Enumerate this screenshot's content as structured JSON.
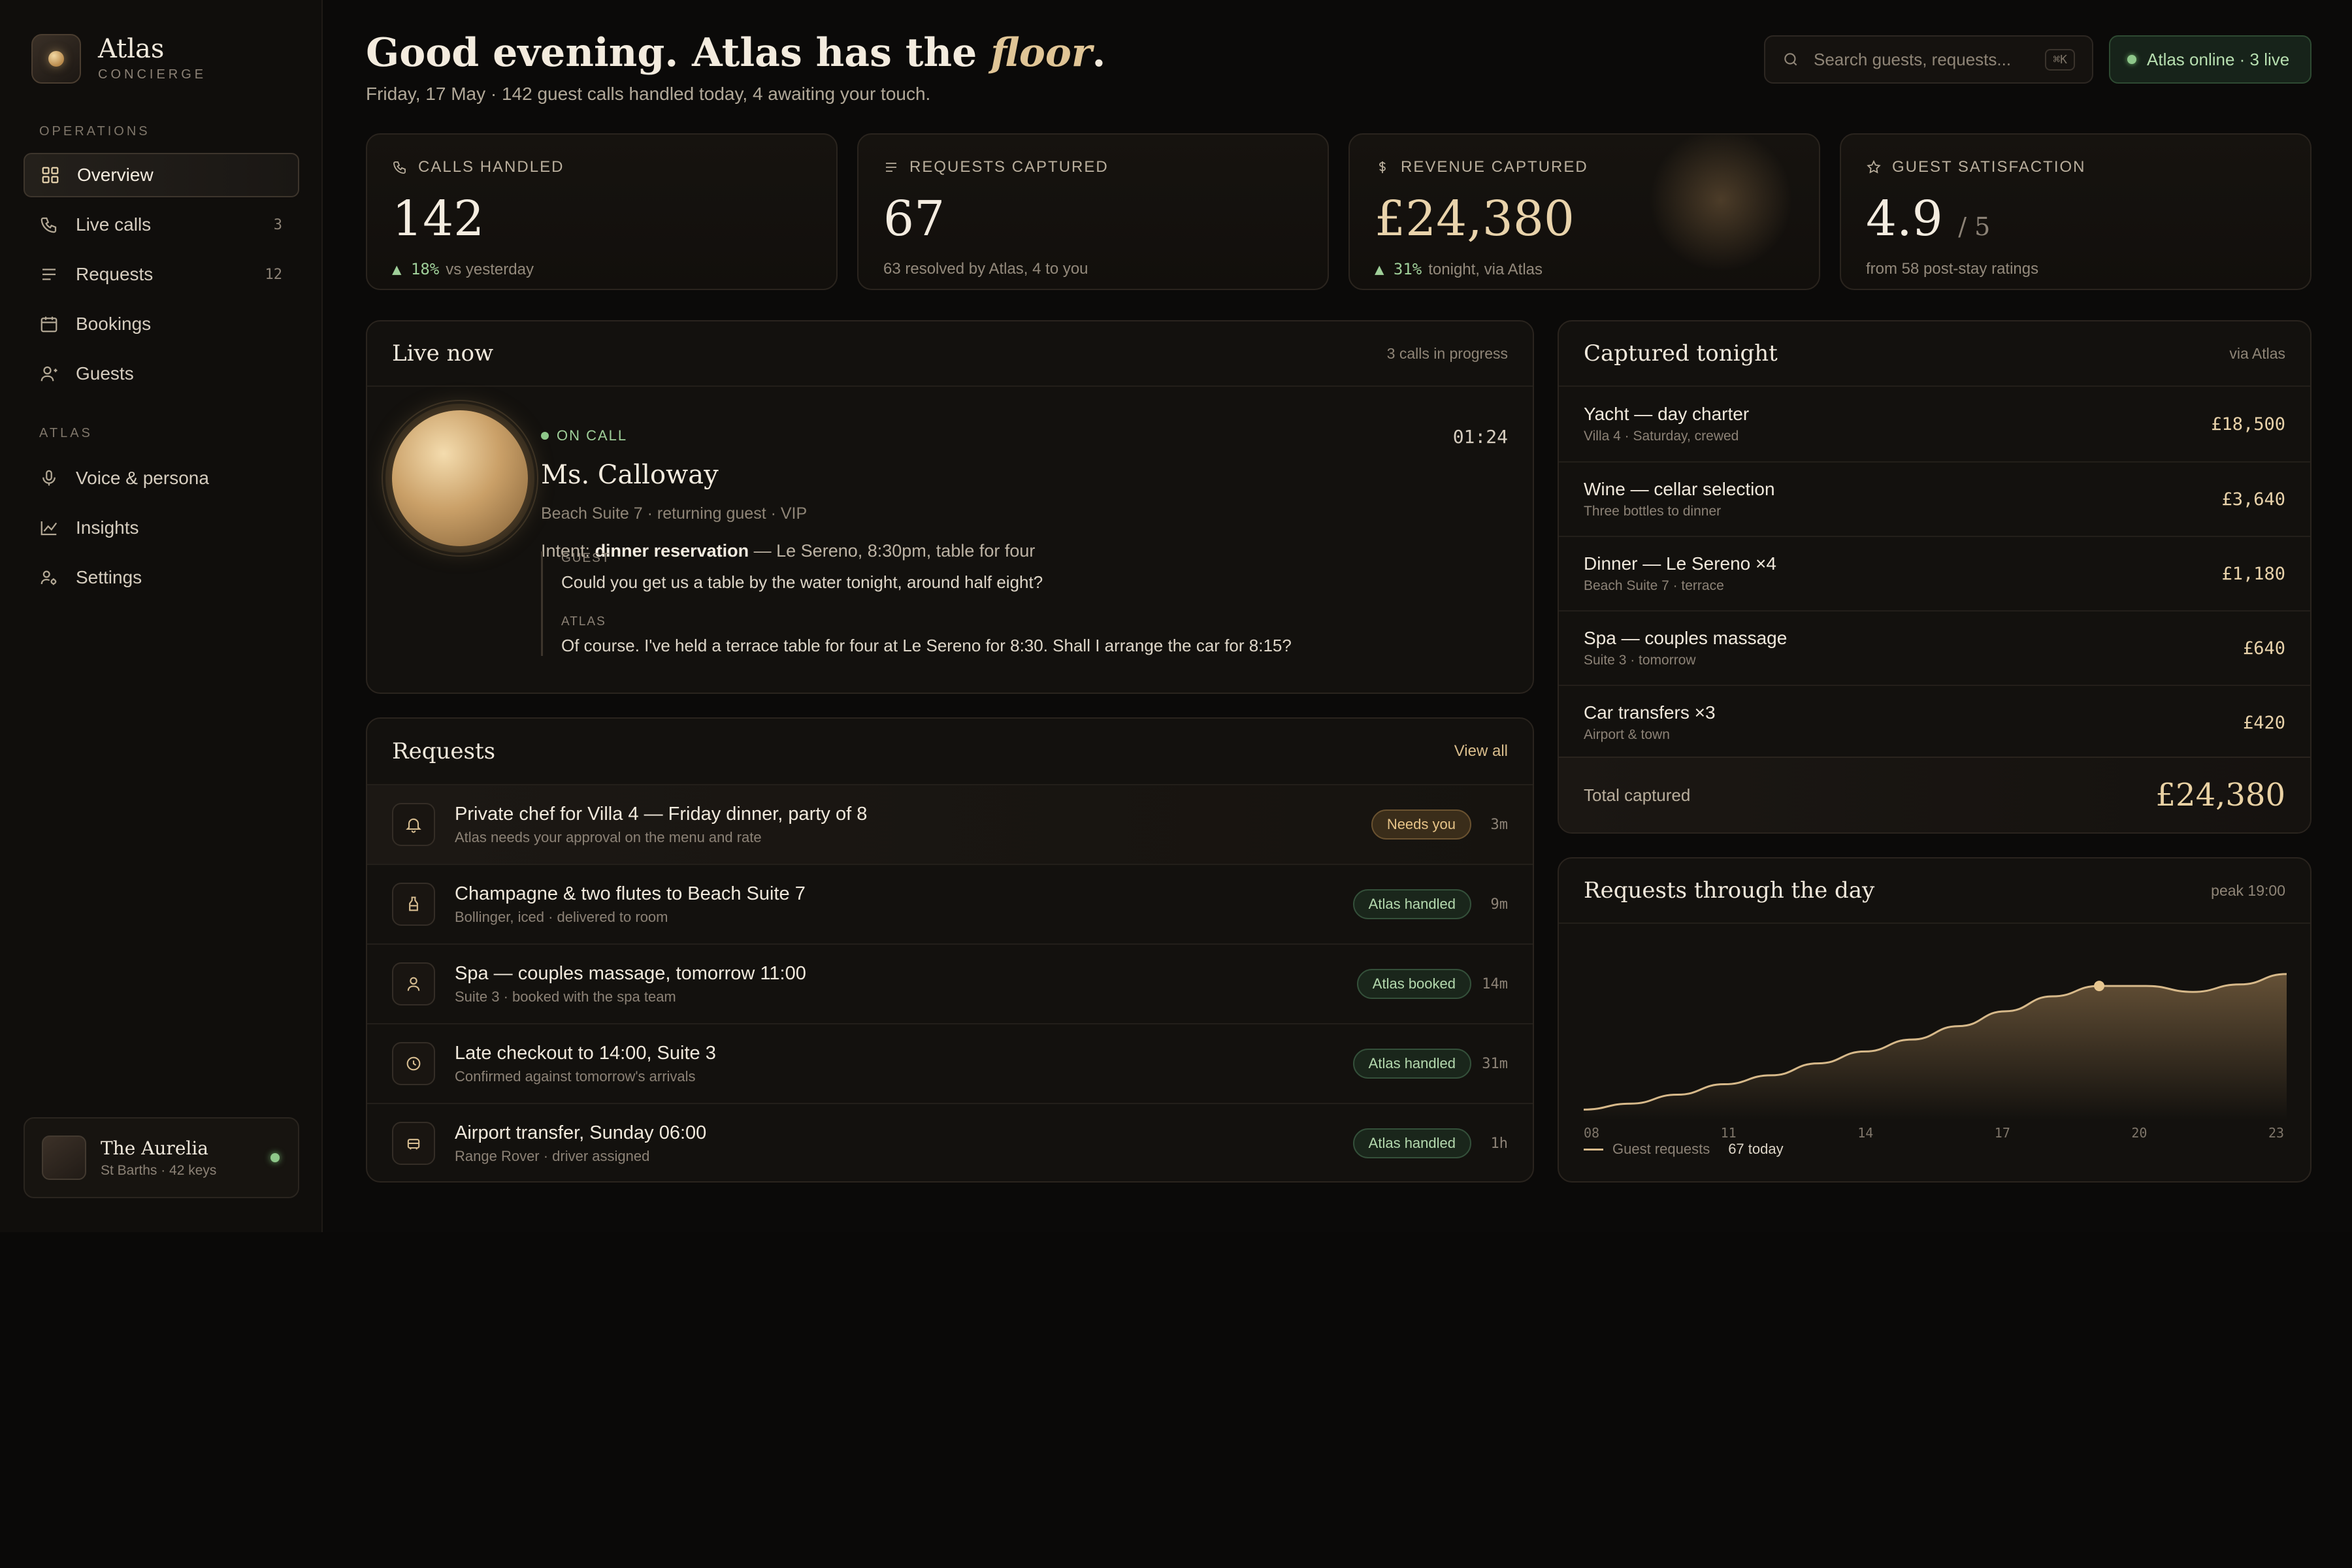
{
  "brand": {
    "name": "Atlas",
    "sub": "CONCIERGE"
  },
  "sidebar": {
    "section_ops": "OPERATIONS",
    "section_atlas": "ATLAS",
    "items": [
      {
        "label": "Overview",
        "icon": "grid-icon",
        "active": true
      },
      {
        "label": "Live calls",
        "icon": "phone-icon",
        "count": "3"
      },
      {
        "label": "Requests",
        "icon": "list-icon",
        "count": "12"
      },
      {
        "label": "Bookings",
        "icon": "calendar-icon"
      },
      {
        "label": "Guests",
        "icon": "user-icon"
      },
      {
        "label": "Voice & persona",
        "icon": "mic-icon"
      },
      {
        "label": "Insights",
        "icon": "trend-icon"
      },
      {
        "label": "Settings",
        "icon": "settings-icon"
      }
    ],
    "property": {
      "name": "The Aurelia",
      "sub": "St Barths · 42 keys"
    }
  },
  "header": {
    "greeting_prefix": "Good evening. Atlas has the ",
    "greeting_em": "floor",
    "greeting_suffix": ".",
    "subline": "Friday, 17 May · 142 guest calls handled today, 4 awaiting your touch.",
    "search_placeholder": "Search guests, requests...",
    "search_kbd": "⌘K",
    "status": "Atlas online · 3 live"
  },
  "stats": [
    {
      "label": "CALLS HANDLED",
      "icon": "phone-icon",
      "value": "142",
      "delta": "▲ 18%",
      "foot": "vs yesterday"
    },
    {
      "label": "REQUESTS CAPTURED",
      "icon": "list-icon",
      "value": "67",
      "foot": "63 resolved by Atlas, 4 to you"
    },
    {
      "label": "REVENUE CAPTURED",
      "icon": "dollar-icon",
      "value": "£24,380",
      "delta": "▲ 31%",
      "foot": "tonight, via Atlas"
    },
    {
      "label": "GUEST SATISFACTION",
      "icon": "star-icon",
      "value": "4.9",
      "unit": "/ 5",
      "foot": "from 58 post-stay ratings"
    }
  ],
  "live": {
    "title": "Live now",
    "meta": "3 calls in progress",
    "status": "ON CALL",
    "timer": "01:24",
    "caller": "Ms. Calloway",
    "caller_sub": "Beach Suite 7 · returning guest · VIP",
    "intent_prefix": "Intent: ",
    "intent_bold": "dinner reservation",
    "intent_rest": " — Le Sereno, 8:30pm, table for four",
    "guest_label": "GUEST",
    "guest_line": "Could you get us a table by the water tonight, around half eight?",
    "atlas_label": "ATLAS",
    "atlas_line": "Of course. I've held a terrace table for four at Le Sereno for 8:30. Shall I arrange the car for 8:15?"
  },
  "requests": {
    "title": "Requests",
    "link": "View all",
    "rows": [
      {
        "title": "Private chef for Villa 4 — Friday dinner, party of 8",
        "sub": "Atlas needs your approval on the menu and rate",
        "badge": "Needs you",
        "badge_kind": "warn",
        "age": "3m",
        "icon": "bell-icon"
      },
      {
        "title": "Champagne & two flutes to Beach Suite 7",
        "sub": "Bollinger, iced · delivered to room",
        "badge": "Atlas handled",
        "badge_kind": "ok",
        "age": "9m",
        "icon": "bottle-icon"
      },
      {
        "title": "Spa — couples massage, tomorrow 11:00",
        "sub": "Suite 3 · booked with the spa team",
        "badge": "Atlas booked",
        "badge_kind": "ok",
        "age": "14m",
        "icon": "person-icon"
      },
      {
        "title": "Late checkout to 14:00, Suite 3",
        "sub": "Confirmed against tomorrow's arrivals",
        "badge": "Atlas handled",
        "badge_kind": "ok",
        "age": "31m",
        "icon": "clock-icon"
      },
      {
        "title": "Airport transfer, Sunday 06:00",
        "sub": "Range Rover · driver assigned",
        "badge": "Atlas handled",
        "badge_kind": "ok",
        "age": "1h",
        "icon": "car-icon"
      }
    ]
  },
  "captured": {
    "title": "Captured tonight",
    "meta": "via Atlas",
    "rows": [
      {
        "title": "Yacht — day charter",
        "sub": "Villa 4 · Saturday, crewed",
        "amount": "£18,500"
      },
      {
        "title": "Wine — cellar selection",
        "sub": "Three bottles to dinner",
        "amount": "£3,640"
      },
      {
        "title": "Dinner — Le Sereno ×4",
        "sub": "Beach Suite 7 · terrace",
        "amount": "£1,180"
      },
      {
        "title": "Spa — couples massage",
        "sub": "Suite 3 · tomorrow",
        "amount": "£640"
      },
      {
        "title": "Car transfers ×3",
        "sub": "Airport & town",
        "amount": "£420"
      }
    ],
    "total_label": "Total captured",
    "total": "£24,380"
  },
  "chart_panel": {
    "title": "Requests through the day",
    "meta": "peak 19:00",
    "legend": "Guest requests",
    "legend_total": "67 today"
  },
  "chart_data": {
    "type": "area",
    "series": [
      {
        "name": "Guest requests",
        "x": [
          8,
          9,
          10,
          11,
          12,
          13,
          14,
          15,
          16,
          17,
          18,
          19,
          20,
          21,
          22,
          23
        ],
        "y": [
          0.6,
          1.0,
          1.6,
          2.3,
          2.9,
          3.7,
          4.5,
          5.3,
          6.2,
          7.2,
          8.2,
          8.9,
          8.9,
          8.5,
          9.0,
          9.7
        ]
      }
    ],
    "x_ticks": [
      "08",
      "11",
      "14",
      "17",
      "20",
      "23"
    ],
    "xlim": [
      8,
      23
    ],
    "ylim": [
      0,
      10
    ],
    "highlight_x": 19,
    "grid": false
  },
  "colors": {
    "accent": "#e0c596",
    "positive": "#9fcf99",
    "warn": "#e7c488",
    "line": "#d7b98a"
  }
}
